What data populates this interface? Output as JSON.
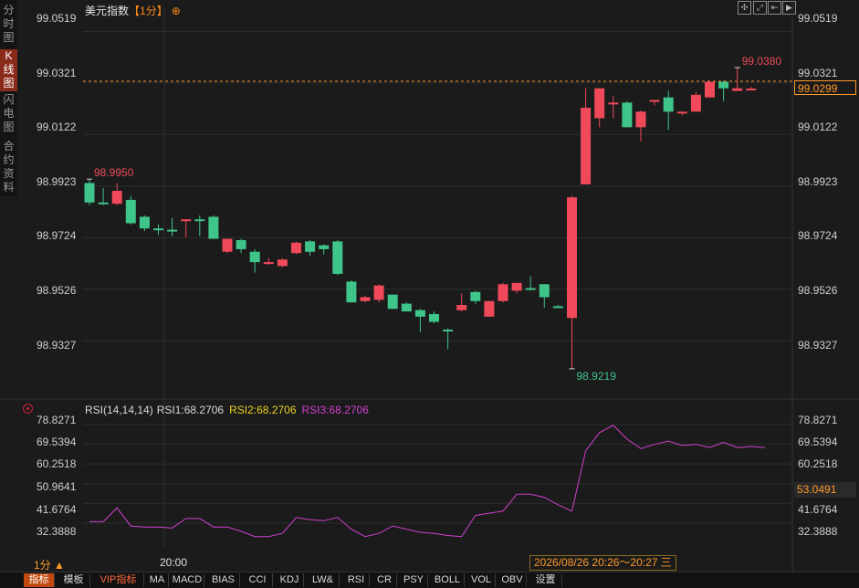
{
  "sidebar": {
    "tabs": [
      {
        "label": "分时图",
        "active": false
      },
      {
        "label": "K线图",
        "active": true
      },
      {
        "label": "闪电图",
        "active": false
      },
      {
        "label": "合约资料",
        "active": false
      }
    ]
  },
  "header": {
    "instrument": "美元指数",
    "period": "【1分】",
    "target_icon": "⊕",
    "tools": [
      "crosshair-icon",
      "expand-icon",
      "restore-icon",
      "next-icon"
    ]
  },
  "price_axis": [
    "99.0519",
    "99.0321",
    "99.0122",
    "98.9923",
    "98.9724",
    "98.9526",
    "98.9327"
  ],
  "current_price": "99.0299",
  "rsi_axis": [
    "78.8271",
    "69.5394",
    "60.2518",
    "50.9641",
    "41.6764",
    "32.3888"
  ],
  "rsi_current": "53.0491",
  "rsi_legend": {
    "name": "RSI(14,14,14)",
    "rsi1": "RSI1:68.2706",
    "rsi2": "RSI2:68.2706",
    "rsi3": "RSI3:68.2706",
    "colors": {
      "rsi1": "#d8d8d8",
      "rsi2": "#e8d020",
      "rsi3": "#d040d0"
    }
  },
  "time_axis": {
    "label": "20:00"
  },
  "period_indicator": "1分 ▲",
  "cursor_time": "2026/08/26 20:26～20:27 三",
  "indicator_bar": [
    {
      "label": "指标",
      "active": true
    },
    {
      "label": "模板",
      "active": false
    },
    {
      "label": "VIP指标",
      "vip": true
    },
    {
      "label": "MA"
    },
    {
      "label": "MACD"
    },
    {
      "label": "BIAS"
    },
    {
      "label": "CCI"
    },
    {
      "label": "KDJ"
    },
    {
      "label": "LW&"
    },
    {
      "label": "RSI"
    },
    {
      "label": "CR"
    },
    {
      "label": "PSY"
    },
    {
      "label": "BOLL"
    },
    {
      "label": "VOL"
    },
    {
      "label": "OBV"
    },
    {
      "label": "设置"
    }
  ],
  "colors": {
    "up": "#f04a5a",
    "down": "#3fc58a",
    "background": "#1b1b1b",
    "accent": "#ff9a2a"
  },
  "chart_data": {
    "type": "candlestick",
    "y_range": [
      98.918,
      99.057
    ],
    "candles": [
      {
        "o": 98.9935,
        "h": 98.995,
        "l": 98.985,
        "c": 98.986
      },
      {
        "o": 98.986,
        "h": 98.9915,
        "l": 98.985,
        "c": 98.9855
      },
      {
        "o": 98.9855,
        "h": 98.9935,
        "l": 98.985,
        "c": 98.9905
      },
      {
        "o": 98.987,
        "h": 98.9885,
        "l": 98.9775,
        "c": 98.978
      },
      {
        "o": 98.9805,
        "h": 98.981,
        "l": 98.975,
        "c": 98.976
      },
      {
        "o": 98.976,
        "h": 98.9775,
        "l": 98.9735,
        "c": 98.9755
      },
      {
        "o": 98.9755,
        "h": 98.98,
        "l": 98.973,
        "c": 98.975
      },
      {
        "o": 98.979,
        "h": 98.9795,
        "l": 98.9725,
        "c": 98.9795
      },
      {
        "o": 98.9795,
        "h": 98.981,
        "l": 98.973,
        "c": 98.979
      },
      {
        "o": 98.9805,
        "h": 98.981,
        "l": 98.9725,
        "c": 98.972
      },
      {
        "o": 98.967,
        "h": 98.972,
        "l": 98.9665,
        "c": 98.972
      },
      {
        "o": 98.9715,
        "h": 98.972,
        "l": 98.9665,
        "c": 98.968
      },
      {
        "o": 98.967,
        "h": 98.968,
        "l": 98.959,
        "c": 98.963
      },
      {
        "o": 98.963,
        "h": 98.9645,
        "l": 98.962,
        "c": 98.963
      },
      {
        "o": 98.9615,
        "h": 98.9645,
        "l": 98.961,
        "c": 98.964
      },
      {
        "o": 98.9665,
        "h": 98.971,
        "l": 98.966,
        "c": 98.9705
      },
      {
        "o": 98.971,
        "h": 98.9715,
        "l": 98.9655,
        "c": 98.967
      },
      {
        "o": 98.9695,
        "h": 98.97,
        "l": 98.966,
        "c": 98.968
      },
      {
        "o": 98.971,
        "h": 98.9715,
        "l": 98.958,
        "c": 98.9585
      },
      {
        "o": 98.9555,
        "h": 98.956,
        "l": 98.9475,
        "c": 98.9475
      },
      {
        "o": 98.948,
        "h": 98.95,
        "l": 98.9475,
        "c": 98.9495
      },
      {
        "o": 98.9485,
        "h": 98.9545,
        "l": 98.9475,
        "c": 98.954
      },
      {
        "o": 98.9505,
        "h": 98.9505,
        "l": 98.945,
        "c": 98.945
      },
      {
        "o": 98.947,
        "h": 98.9475,
        "l": 98.944,
        "c": 98.944
      },
      {
        "o": 98.9445,
        "h": 98.945,
        "l": 98.936,
        "c": 98.942
      },
      {
        "o": 98.943,
        "h": 98.944,
        "l": 98.9395,
        "c": 98.94
      },
      {
        "o": 98.937,
        "h": 98.9375,
        "l": 98.9295,
        "c": 98.9365
      },
      {
        "o": 98.9445,
        "h": 98.951,
        "l": 98.944,
        "c": 98.9465
      },
      {
        "o": 98.9515,
        "h": 98.952,
        "l": 98.947,
        "c": 98.948
      },
      {
        "o": 98.942,
        "h": 98.948,
        "l": 98.942,
        "c": 98.948
      },
      {
        "o": 98.948,
        "h": 98.955,
        "l": 98.9475,
        "c": 98.9545
      },
      {
        "o": 98.952,
        "h": 98.9545,
        "l": 98.951,
        "c": 98.955
      },
      {
        "o": 98.953,
        "h": 98.9575,
        "l": 98.952,
        "c": 98.9525
      },
      {
        "o": 98.9545,
        "h": 98.9545,
        "l": 98.9455,
        "c": 98.9495
      },
      {
        "o": 98.946,
        "h": 98.9465,
        "l": 98.9455,
        "c": 98.9455
      },
      {
        "o": 98.9415,
        "h": 98.9885,
        "l": 98.9219,
        "c": 98.988
      },
      {
        "o": 98.993,
        "h": 99.03,
        "l": 98.993,
        "c": 99.0225
      },
      {
        "o": 99.0185,
        "h": 99.03,
        "l": 99.015,
        "c": 99.03
      },
      {
        "o": 99.0245,
        "h": 99.027,
        "l": 99.0185,
        "c": 99.0245
      },
      {
        "o": 99.0245,
        "h": 99.025,
        "l": 99.015,
        "c": 99.015
      },
      {
        "o": 99.015,
        "h": 99.0215,
        "l": 99.0095,
        "c": 99.021
      },
      {
        "o": 99.025,
        "h": 99.0255,
        "l": 99.0235,
        "c": 99.0255
      },
      {
        "o": 99.0265,
        "h": 99.029,
        "l": 99.014,
        "c": 99.021
      },
      {
        "o": 99.0205,
        "h": 99.021,
        "l": 99.0195,
        "c": 99.021
      },
      {
        "o": 99.021,
        "h": 99.0285,
        "l": 99.021,
        "c": 99.0275
      },
      {
        "o": 99.0265,
        "h": 99.033,
        "l": 99.0265,
        "c": 99.0325
      },
      {
        "o": 99.0325,
        "h": 99.033,
        "l": 99.025,
        "c": 99.03
      },
      {
        "o": 99.029,
        "h": 99.038,
        "l": 99.029,
        "c": 99.03
      },
      {
        "o": 99.0299,
        "h": 99.0305,
        "l": 99.0295,
        "c": 99.0299
      }
    ],
    "markers": [
      {
        "label": "98.9950",
        "value": 98.995,
        "type": "high"
      },
      {
        "label": "99.0380",
        "value": 99.038,
        "type": "high"
      },
      {
        "label": "98.9219",
        "value": 98.9219,
        "type": "low"
      }
    ],
    "rsi": {
      "y_range": [
        25.0,
        81.0
      ],
      "values": [
        33.0,
        33.0,
        39.5,
        31.0,
        30.5,
        30.5,
        30.0,
        34.5,
        34.5,
        30.5,
        30.5,
        28.5,
        26.0,
        26.0,
        27.5,
        35.0,
        34.0,
        33.5,
        35.0,
        29.5,
        26.0,
        27.5,
        31.0,
        29.5,
        28.0,
        27.5,
        26.5,
        26.0,
        36.0,
        37.0,
        38.0,
        46.0,
        46.0,
        44.5,
        41.0,
        38.0,
        66.5,
        75.0,
        78.5,
        72.0,
        67.5,
        69.5,
        71.0,
        69.0,
        69.5,
        68.0,
        70.5,
        68.0,
        68.5,
        68.0
      ]
    }
  }
}
